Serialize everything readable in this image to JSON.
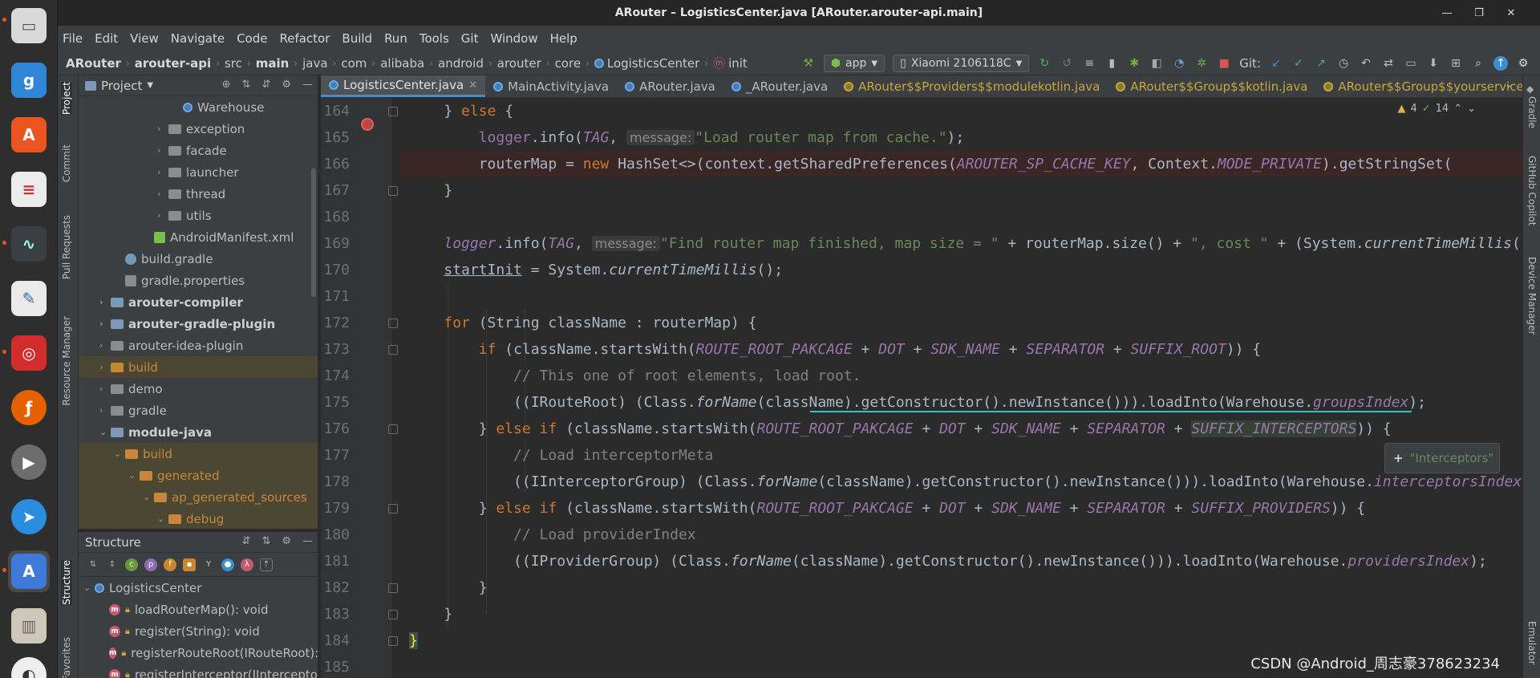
{
  "window": {
    "title": "ARouter – LogisticsCenter.java [ARouter.arouter-api.main]"
  },
  "menu": [
    "File",
    "Edit",
    "View",
    "Navigate",
    "Code",
    "Refactor",
    "Build",
    "Run",
    "Tools",
    "Git",
    "Window",
    "Help"
  ],
  "breadcrumbs": [
    "ARouter",
    "arouter-api",
    "src",
    "main",
    "java",
    "com",
    "alibaba",
    "android",
    "arouter",
    "core",
    "LogisticsCenter",
    "init"
  ],
  "toolbar": {
    "run_config": "app",
    "device": "Xiaomi 2106118C",
    "git_label": "Git:"
  },
  "stripes": {
    "left": [
      "Project",
      "Commit",
      "Pull Requests",
      "Resource Manager",
      "Structure",
      "Favorites"
    ],
    "right": [
      "Gradle",
      "GitHub Copilot",
      "Device Manager",
      "Emulator"
    ]
  },
  "project_panel": {
    "title": "Project",
    "tree": [
      {
        "label": "Warehouse",
        "indent": 6,
        "kind": "class",
        "arrow": ""
      },
      {
        "label": "exception",
        "indent": 5,
        "kind": "package",
        "arrow": "›"
      },
      {
        "label": "facade",
        "indent": 5,
        "kind": "package",
        "arrow": "›"
      },
      {
        "label": "launcher",
        "indent": 5,
        "kind": "package",
        "arrow": "›"
      },
      {
        "label": "thread",
        "indent": 5,
        "kind": "package",
        "arrow": "›"
      },
      {
        "label": "utils",
        "indent": 5,
        "kind": "package",
        "arrow": "›"
      },
      {
        "label": "AndroidManifest.xml",
        "indent": 4,
        "kind": "xml",
        "arrow": ""
      },
      {
        "label": "build.gradle",
        "indent": 2,
        "kind": "gradle",
        "arrow": ""
      },
      {
        "label": "gradle.properties",
        "indent": 2,
        "kind": "props",
        "arrow": ""
      },
      {
        "label": "arouter-compiler",
        "indent": 1,
        "kind": "module",
        "arrow": "›",
        "bold": true
      },
      {
        "label": "arouter-gradle-plugin",
        "indent": 1,
        "kind": "module",
        "arrow": "›",
        "bold": true
      },
      {
        "label": "arouter-idea-plugin",
        "indent": 1,
        "kind": "folder",
        "arrow": "›"
      },
      {
        "label": "build",
        "indent": 1,
        "kind": "orange",
        "arrow": "›",
        "hl": true
      },
      {
        "label": "demo",
        "indent": 1,
        "kind": "folder",
        "arrow": "›"
      },
      {
        "label": "gradle",
        "indent": 1,
        "kind": "folder",
        "arrow": "›"
      },
      {
        "label": "module-java",
        "indent": 1,
        "kind": "module",
        "arrow": "⌄",
        "bold": true
      },
      {
        "label": "build",
        "indent": 2,
        "kind": "orange",
        "arrow": "⌄",
        "hl": true
      },
      {
        "label": "generated",
        "indent": 3,
        "kind": "orange",
        "arrow": "⌄",
        "hl": true
      },
      {
        "label": "ap_generated_sources",
        "indent": 4,
        "kind": "orange",
        "arrow": "⌄",
        "hl": true
      },
      {
        "label": "debug",
        "indent": 5,
        "kind": "orange",
        "arrow": "⌄",
        "hl": true
      }
    ]
  },
  "structure_panel": {
    "title": "Structure",
    "root": "LogisticsCenter",
    "members": [
      "loadRouterMap(): void",
      "register(String): void",
      "registerRouteRoot(IRouteRoot):",
      "registerInterceptor(IIntercepto"
    ]
  },
  "tabs": [
    {
      "label": "LogisticsCenter.java",
      "active": true,
      "generated": false
    },
    {
      "label": "MainActivity.java",
      "active": false,
      "generated": false
    },
    {
      "label": "ARouter.java",
      "active": false,
      "generated": false
    },
    {
      "label": "_ARouter.java",
      "active": false,
      "generated": false
    },
    {
      "label": "ARouter$$Providers$$modulekotlin.java",
      "active": false,
      "generated": true
    },
    {
      "label": "ARouter$$Group$$kotlin.java",
      "active": false,
      "generated": true
    },
    {
      "label": "ARouter$$Group$$yourservice",
      "active": false,
      "generated": true
    }
  ],
  "inspections": {
    "warnings": "4",
    "ok": "14"
  },
  "editor": {
    "line_numbers": [
      "164",
      "165",
      "166",
      "167",
      "168",
      "169",
      "170",
      "171",
      "172",
      "173",
      "174",
      "175",
      "176",
      "177",
      "178",
      "179",
      "180",
      "181",
      "182",
      "183",
      "184",
      "185"
    ],
    "hint_message": "message:",
    "popup_text": "\"Interceptors\""
  },
  "watermark": "CSDN @Android_周志豪378623234",
  "colors": {
    "keyword": "#cc7832",
    "string": "#6a8759",
    "field": "#9876aa",
    "comment": "#808080",
    "accent": "#4a88c7"
  }
}
